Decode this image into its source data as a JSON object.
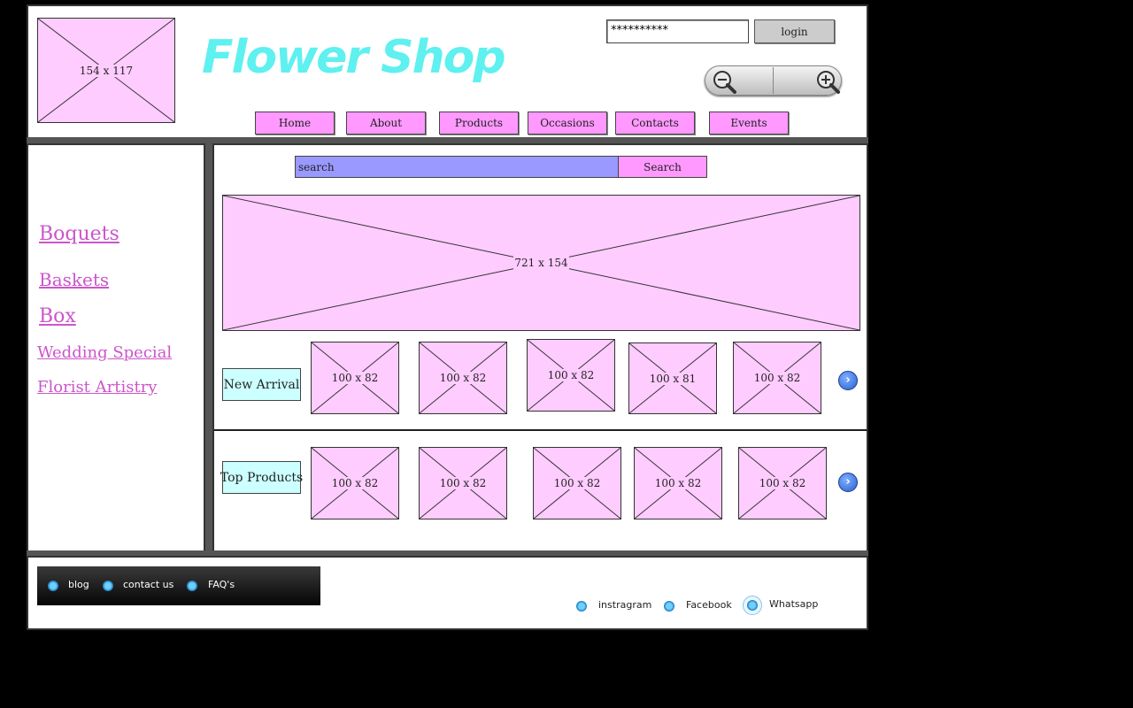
{
  "header": {
    "logo_placeholder": "154 x 117",
    "title": "Flower Shop",
    "password_value": "**********",
    "login_label": "login",
    "zoom_out_icon": "zoom-out-icon",
    "zoom_in_icon": "zoom-in-icon"
  },
  "nav": {
    "items": [
      {
        "label": "Home"
      },
      {
        "label": "About"
      },
      {
        "label": "Products"
      },
      {
        "label": "Occasions"
      },
      {
        "label": "Contacts"
      },
      {
        "label": "Events"
      }
    ]
  },
  "sidebar": {
    "links": [
      {
        "label": "Boquets"
      },
      {
        "label": "Baskets"
      },
      {
        "label": "Box"
      },
      {
        "label": "Wedding Special"
      },
      {
        "label": "Florist Artistry"
      }
    ]
  },
  "search": {
    "value": "search",
    "button_label": "Search"
  },
  "banner": {
    "placeholder": "721 x 154"
  },
  "new_arrival": {
    "label": "New Arrival",
    "items": [
      "100 x 82",
      "100 x 82",
      "100 x 82",
      "100 x 81",
      "100 x 82"
    ]
  },
  "top_products": {
    "label": "Top Products",
    "items": [
      "100 x 82",
      "100 x 82",
      "100 x 82",
      "100 x 82",
      "100 x 82"
    ]
  },
  "footer": {
    "links": [
      {
        "label": "blog"
      },
      {
        "label": "contact us"
      },
      {
        "label": "FAQ's"
      }
    ],
    "social": [
      {
        "label": "instragram"
      },
      {
        "label": "Facebook"
      },
      {
        "label": "Whatsapp"
      }
    ]
  },
  "colors": {
    "title": "#5ff0f0",
    "nav_button": "#ff99ff",
    "placeholder": "#ffccff",
    "search_field": "#9999ff",
    "label_box": "#ccffff",
    "sidebar_link": "#cc55cc"
  }
}
